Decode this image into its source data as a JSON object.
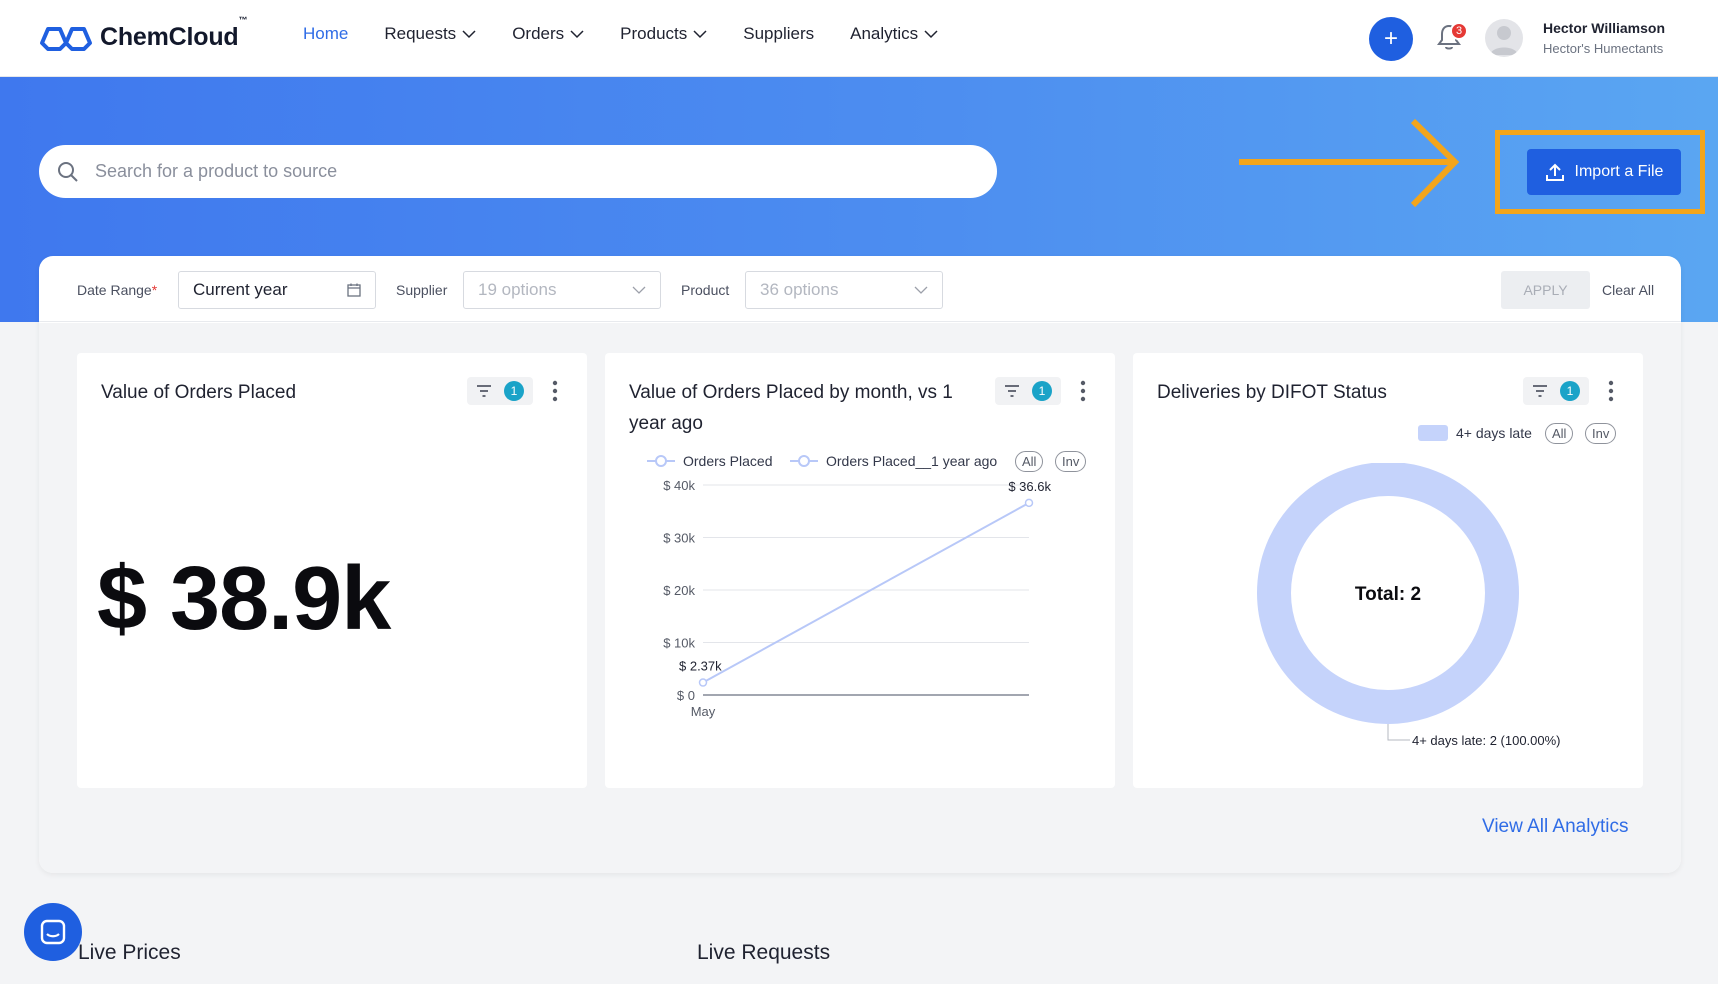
{
  "brand": {
    "name": "ChemCloud",
    "tm": "™"
  },
  "nav": {
    "items": [
      {
        "label": "Home",
        "active": true,
        "dropdown": false
      },
      {
        "label": "Requests",
        "dropdown": true
      },
      {
        "label": "Orders",
        "dropdown": true
      },
      {
        "label": "Products",
        "dropdown": true
      },
      {
        "label": "Suppliers",
        "dropdown": false
      },
      {
        "label": "Analytics",
        "dropdown": true
      }
    ],
    "notifications_count": "3",
    "user": {
      "name": "Hector Williamson",
      "company": "Hector's Humectants"
    }
  },
  "hero": {
    "search_placeholder": "Search for a product to source",
    "import_label": "Import a File",
    "highlight_color": "#f3a51b"
  },
  "filters": {
    "date_range_label": "Date Range",
    "date_range_required": "*",
    "date_range_value": "Current year",
    "supplier_label": "Supplier",
    "supplier_value": "19 options",
    "product_label": "Product",
    "product_value": "36 options",
    "apply_label": "APPLY",
    "clear_label": "Clear All"
  },
  "widgets": {
    "value_orders": {
      "title": "Value of Orders Placed",
      "filter_count": "1",
      "value": "$ 38.9k"
    },
    "orders_by_month": {
      "title_line1": "Value of Orders Placed by month, vs 1",
      "title_line2": "year ago",
      "filter_count": "1",
      "legend": [
        "Orders Placed",
        "Orders Placed__1 year ago"
      ],
      "pill_all": "All",
      "pill_inv": "Inv"
    },
    "difot": {
      "title": "Deliveries by DIFOT Status",
      "filter_count": "1",
      "legend": "4+ days late",
      "pill_all": "All",
      "pill_inv": "Inv",
      "center_label": "Total: 2",
      "slice_label": "4+ days late: 2 (100.00%)"
    }
  },
  "chart_data": [
    {
      "type": "line",
      "x": [
        "May"
      ],
      "series": [
        {
          "name": "Orders Placed",
          "points": [
            {
              "x": "May",
              "y": 2370
            },
            {
              "x": "",
              "y": 36600
            }
          ],
          "labels": [
            "$ 2.37k",
            "$ 36.6k"
          ]
        },
        {
          "name": "Orders Placed__1 year ago",
          "points": []
        }
      ],
      "yticks": [
        "$ 40k",
        "$ 30k",
        "$ 20k",
        "$ 10k",
        "$ 0"
      ],
      "ylim": [
        0,
        40000
      ],
      "grid": true,
      "legend_position": "top",
      "color": "#b8c8f8"
    },
    {
      "type": "pie",
      "donut": true,
      "slices": [
        {
          "label": "4+ days late",
          "value": 2,
          "percent": 100.0
        }
      ],
      "total": 2,
      "color": "#c5d3fb"
    }
  ],
  "view_all_label": "View All Analytics",
  "sections": {
    "prices": "Live Prices",
    "requests": "Live Requests"
  }
}
